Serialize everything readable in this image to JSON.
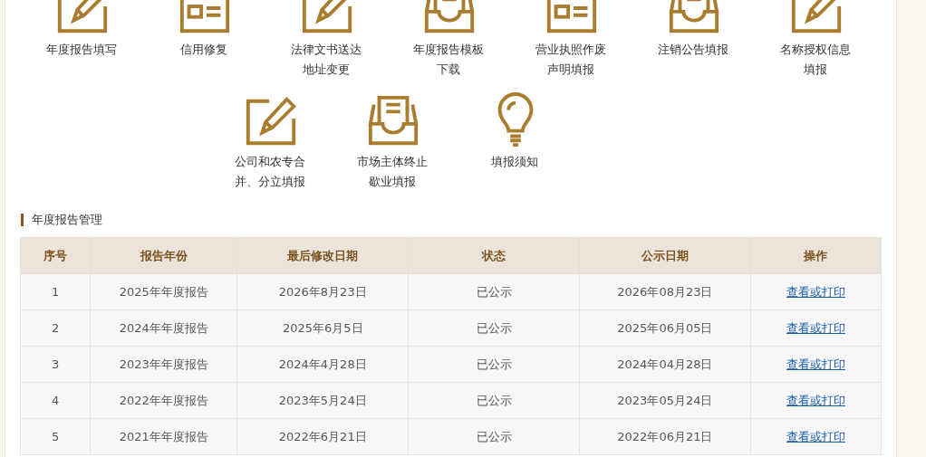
{
  "services": [
    [
      {
        "label": "年度报告填写",
        "kind": "edit"
      },
      {
        "label": "信用修复",
        "kind": "card"
      },
      {
        "label": "法律文书送达地址变更",
        "kind": "edit"
      },
      {
        "label": "年度报告模板下载",
        "kind": "tray"
      },
      {
        "label": "营业执照作废声明填报",
        "kind": "card"
      },
      {
        "label": "注销公告填报",
        "kind": "tray"
      },
      {
        "label": "名称授权信息填报",
        "kind": "edit"
      }
    ],
    [
      {
        "label": "公司和农专合并、分立填报",
        "kind": "edit"
      },
      {
        "label": "市场主体终止歇业填报",
        "kind": "tray"
      },
      {
        "label": "填报须知",
        "kind": "bulb"
      }
    ]
  ],
  "section_title": "年度报告管理",
  "table": {
    "columns": [
      "序号",
      "报告年份",
      "最后修改日期",
      "状态",
      "公示日期",
      "操作"
    ],
    "rows": [
      [
        "1",
        "2025年年度报告",
        "2026年8月23日",
        "已公示",
        "2026年08月23日",
        "查看或打印"
      ],
      [
        "2",
        "2024年年度报告",
        "2025年6月5日",
        "已公示",
        "2025年06月05日",
        "查看或打印"
      ],
      [
        "3",
        "2023年年度报告",
        "2024年4月28日",
        "已公示",
        "2024年04月28日",
        "查看或打印"
      ],
      [
        "4",
        "2022年年度报告",
        "2023年5月24日",
        "已公示",
        "2023年05月24日",
        "查看或打印"
      ],
      [
        "5",
        "2021年年度报告",
        "2022年6月21日",
        "已公示",
        "2022年06月21日",
        "查看或打印"
      ]
    ]
  }
}
